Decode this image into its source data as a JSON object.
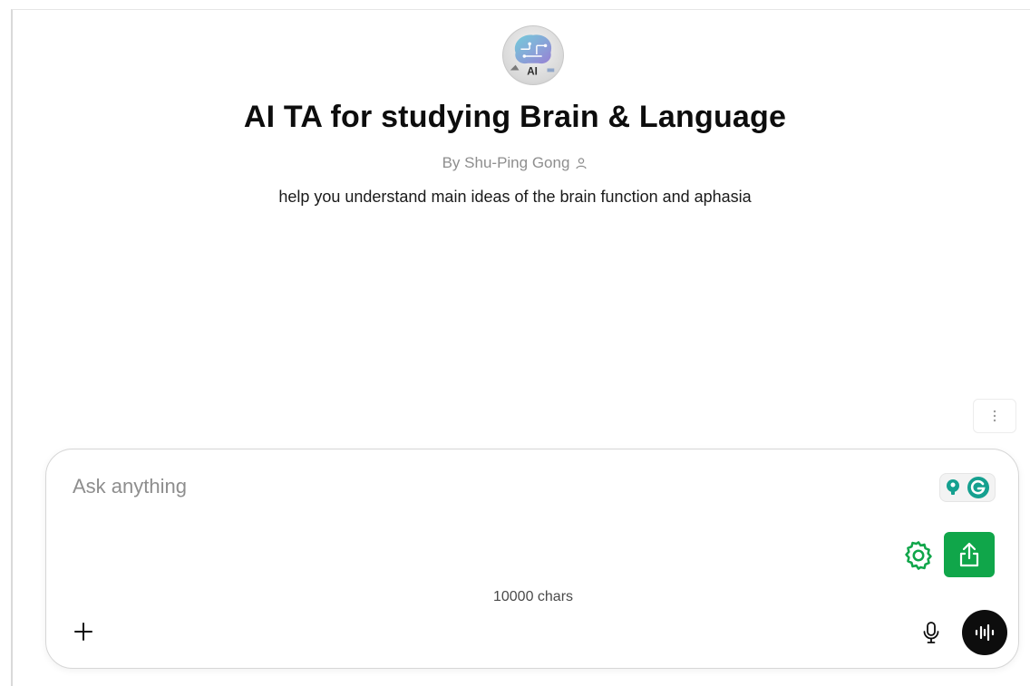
{
  "gpt": {
    "title": "AI TA for studying Brain & Language",
    "byline": "By Shu-Ping Gong",
    "description": "help you understand main ideas of the brain function and aphasia",
    "avatar_text": "AI"
  },
  "composer": {
    "placeholder": "Ask anything",
    "value": "",
    "char_count": "10000 chars"
  },
  "icons": {
    "avatar": "brain-ai-logo",
    "byline": "person-icon",
    "menu": "more-vertical-icon",
    "extension": "grammarly-icon",
    "settings": "gear-icon",
    "share": "share-upload-icon",
    "attach": "plus-icon",
    "dictate": "microphone-icon",
    "voice": "voice-waveform-icon"
  },
  "colors": {
    "accent_green": "#10a64a",
    "voice_button": "#0d0d0d",
    "muted_text": "#8e8e8e"
  }
}
